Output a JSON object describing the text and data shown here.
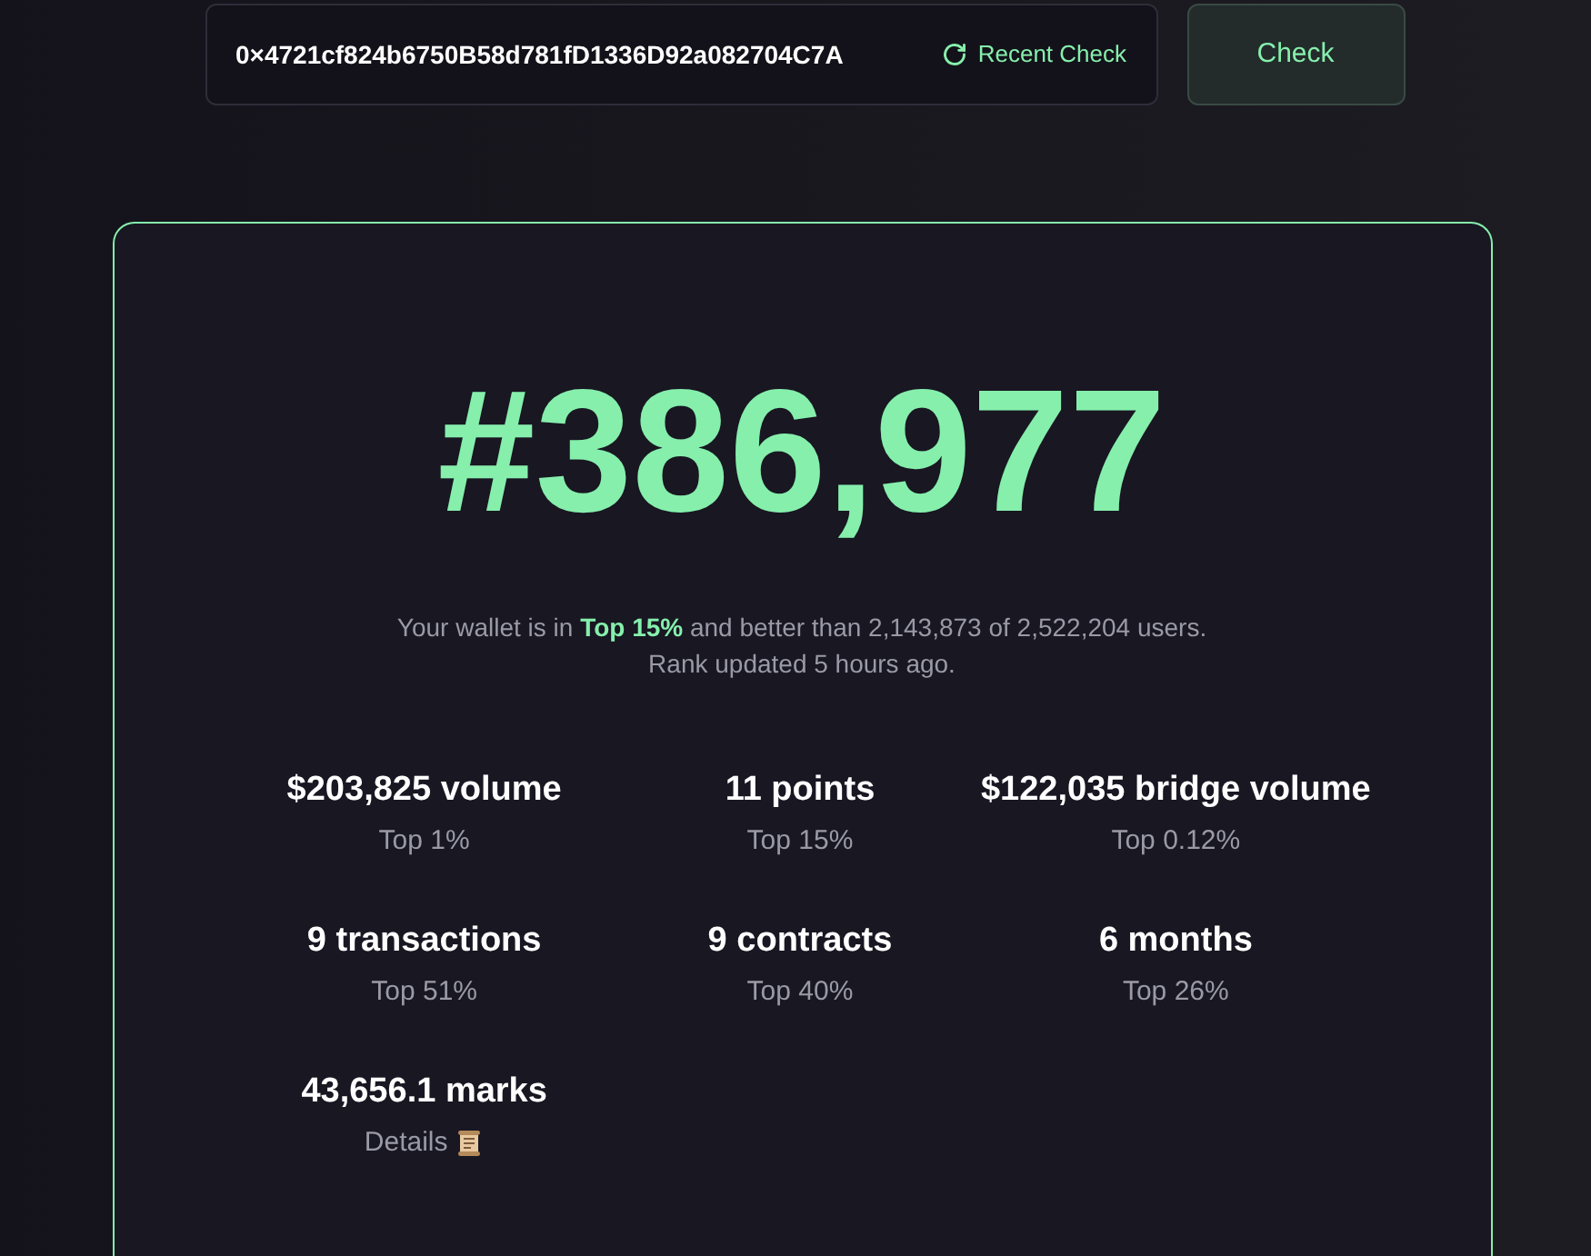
{
  "search": {
    "value": "0×4721cf824b6750B58d781fD1336D92a082704C7A",
    "recent_label": "Recent Check"
  },
  "check_button": "Check",
  "rank": "#386,977",
  "summary": {
    "before": "Your wallet is in ",
    "highlight": "Top 15%",
    "after": " and better than 2,143,873 of 2,522,204 users.",
    "updated": "Rank updated 5 hours ago."
  },
  "stats": [
    {
      "kind": "plain",
      "value": "$203,825 volume",
      "sub": "Top 1%"
    },
    {
      "kind": "plain",
      "value": "11 points",
      "sub": "Top 15%"
    },
    {
      "kind": "plain",
      "value": "$122,035 bridge volume",
      "sub": "Top 0.12%"
    },
    {
      "kind": "plain",
      "value": "9 transactions",
      "sub": "Top 51%"
    },
    {
      "kind": "plain",
      "value": "9 contracts",
      "sub": "Top 40%"
    },
    {
      "kind": "plain",
      "value": "6 months",
      "sub": "Top 26%"
    },
    {
      "kind": "details",
      "value": "43,656.1 marks",
      "sub": "Details"
    }
  ]
}
